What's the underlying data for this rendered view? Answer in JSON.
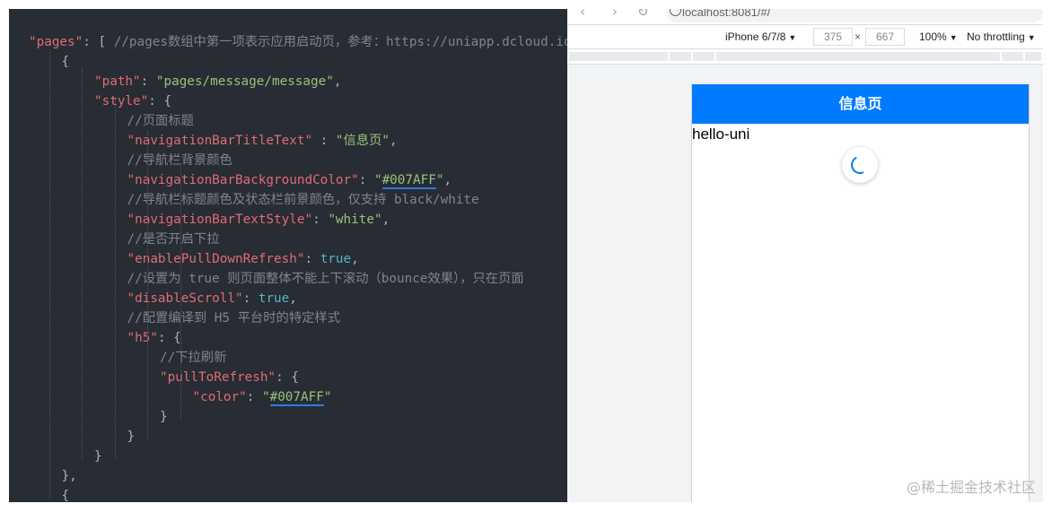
{
  "editor": {
    "lines": [
      [
        {
          "t": "\"pages\"",
          "c": "key"
        },
        {
          "t": ": [ ",
          "c": "punc"
        },
        {
          "t": "//pages数组中第一项表示应用启动页，参考：https://uniapp.dcloud.io/collocation/pages",
          "c": "com"
        }
      ],
      [
        {
          "t": "{",
          "c": "punc"
        }
      ],
      [
        {
          "t": "\"path\"",
          "c": "key"
        },
        {
          "t": ": ",
          "c": "punc"
        },
        {
          "t": "\"pages/message/message\"",
          "c": "str"
        },
        {
          "t": ",",
          "c": "punc"
        }
      ],
      [
        {
          "t": "\"style\"",
          "c": "key"
        },
        {
          "t": ": {",
          "c": "punc"
        }
      ],
      [
        {
          "t": "//页面标题",
          "c": "com"
        }
      ],
      [
        {
          "t": "\"navigationBarTitleText\"",
          "c": "key"
        },
        {
          "t": " : ",
          "c": "punc"
        },
        {
          "t": "\"信息页\"",
          "c": "str"
        },
        {
          "t": ",",
          "c": "punc"
        }
      ],
      [
        {
          "t": "//导航栏背景颜色",
          "c": "com"
        }
      ],
      [
        {
          "t": "\"navigationBarBackgroundColor\"",
          "c": "key"
        },
        {
          "t": ": ",
          "c": "punc"
        },
        {
          "t": "\"",
          "c": "str"
        },
        {
          "t": "#007AFF",
          "c": "color"
        },
        {
          "t": "\"",
          "c": "str"
        },
        {
          "t": ",",
          "c": "punc"
        }
      ],
      [
        {
          "t": "//导航栏标题颜色及状态栏前景颜色，仅支持 black/white",
          "c": "com"
        }
      ],
      [
        {
          "t": "\"navigationBarTextStyle\"",
          "c": "key"
        },
        {
          "t": ": ",
          "c": "punc"
        },
        {
          "t": "\"white\"",
          "c": "str"
        },
        {
          "t": ",",
          "c": "punc"
        }
      ],
      [
        {
          "t": "//是否开启下拉",
          "c": "com"
        }
      ],
      [
        {
          "t": "\"enablePullDownRefresh\"",
          "c": "key"
        },
        {
          "t": ": ",
          "c": "punc"
        },
        {
          "t": "true",
          "c": "bool"
        },
        {
          "t": ",",
          "c": "punc"
        }
      ],
      [
        {
          "t": "//设置为 true 则页面整体不能上下滚动（bounce效果），只在页面",
          "c": "com"
        }
      ],
      [
        {
          "t": "\"disableScroll\"",
          "c": "key"
        },
        {
          "t": ": ",
          "c": "punc"
        },
        {
          "t": "true",
          "c": "bool"
        },
        {
          "t": ",",
          "c": "punc"
        }
      ],
      [
        {
          "t": "//配置编译到 H5 平台时的特定样式",
          "c": "com"
        }
      ],
      [
        {
          "t": "\"h5\"",
          "c": "key"
        },
        {
          "t": ": {",
          "c": "punc"
        }
      ],
      [
        {
          "t": "//下拉刷新",
          "c": "com"
        }
      ],
      [
        {
          "t": "\"pullToRefresh\"",
          "c": "key"
        },
        {
          "t": ": {",
          "c": "punc"
        }
      ],
      [
        {
          "t": "\"color\"",
          "c": "key"
        },
        {
          "t": ": ",
          "c": "punc"
        },
        {
          "t": "\"",
          "c": "str"
        },
        {
          "t": "#007AFF",
          "c": "color"
        },
        {
          "t": "\"",
          "c": "str"
        }
      ],
      [
        {
          "t": "}",
          "c": "punc"
        }
      ],
      [
        {
          "t": "}",
          "c": "punc"
        }
      ],
      [
        {
          "t": "}",
          "c": "punc"
        }
      ],
      [
        {
          "t": "},",
          "c": "punc"
        }
      ],
      [
        {
          "t": "{",
          "c": "punc"
        }
      ]
    ]
  },
  "browser": {
    "url": "localhost:8081/#/",
    "device": "iPhone 6/7/8",
    "width": "375",
    "times": "×",
    "height": "667",
    "zoom": "100%",
    "throttle": "No throttling"
  },
  "phone": {
    "nav_title": "信息页",
    "nav_color": "#007AFF",
    "body_text": "hello-uni"
  },
  "watermark": "@稀土掘金技术社区"
}
